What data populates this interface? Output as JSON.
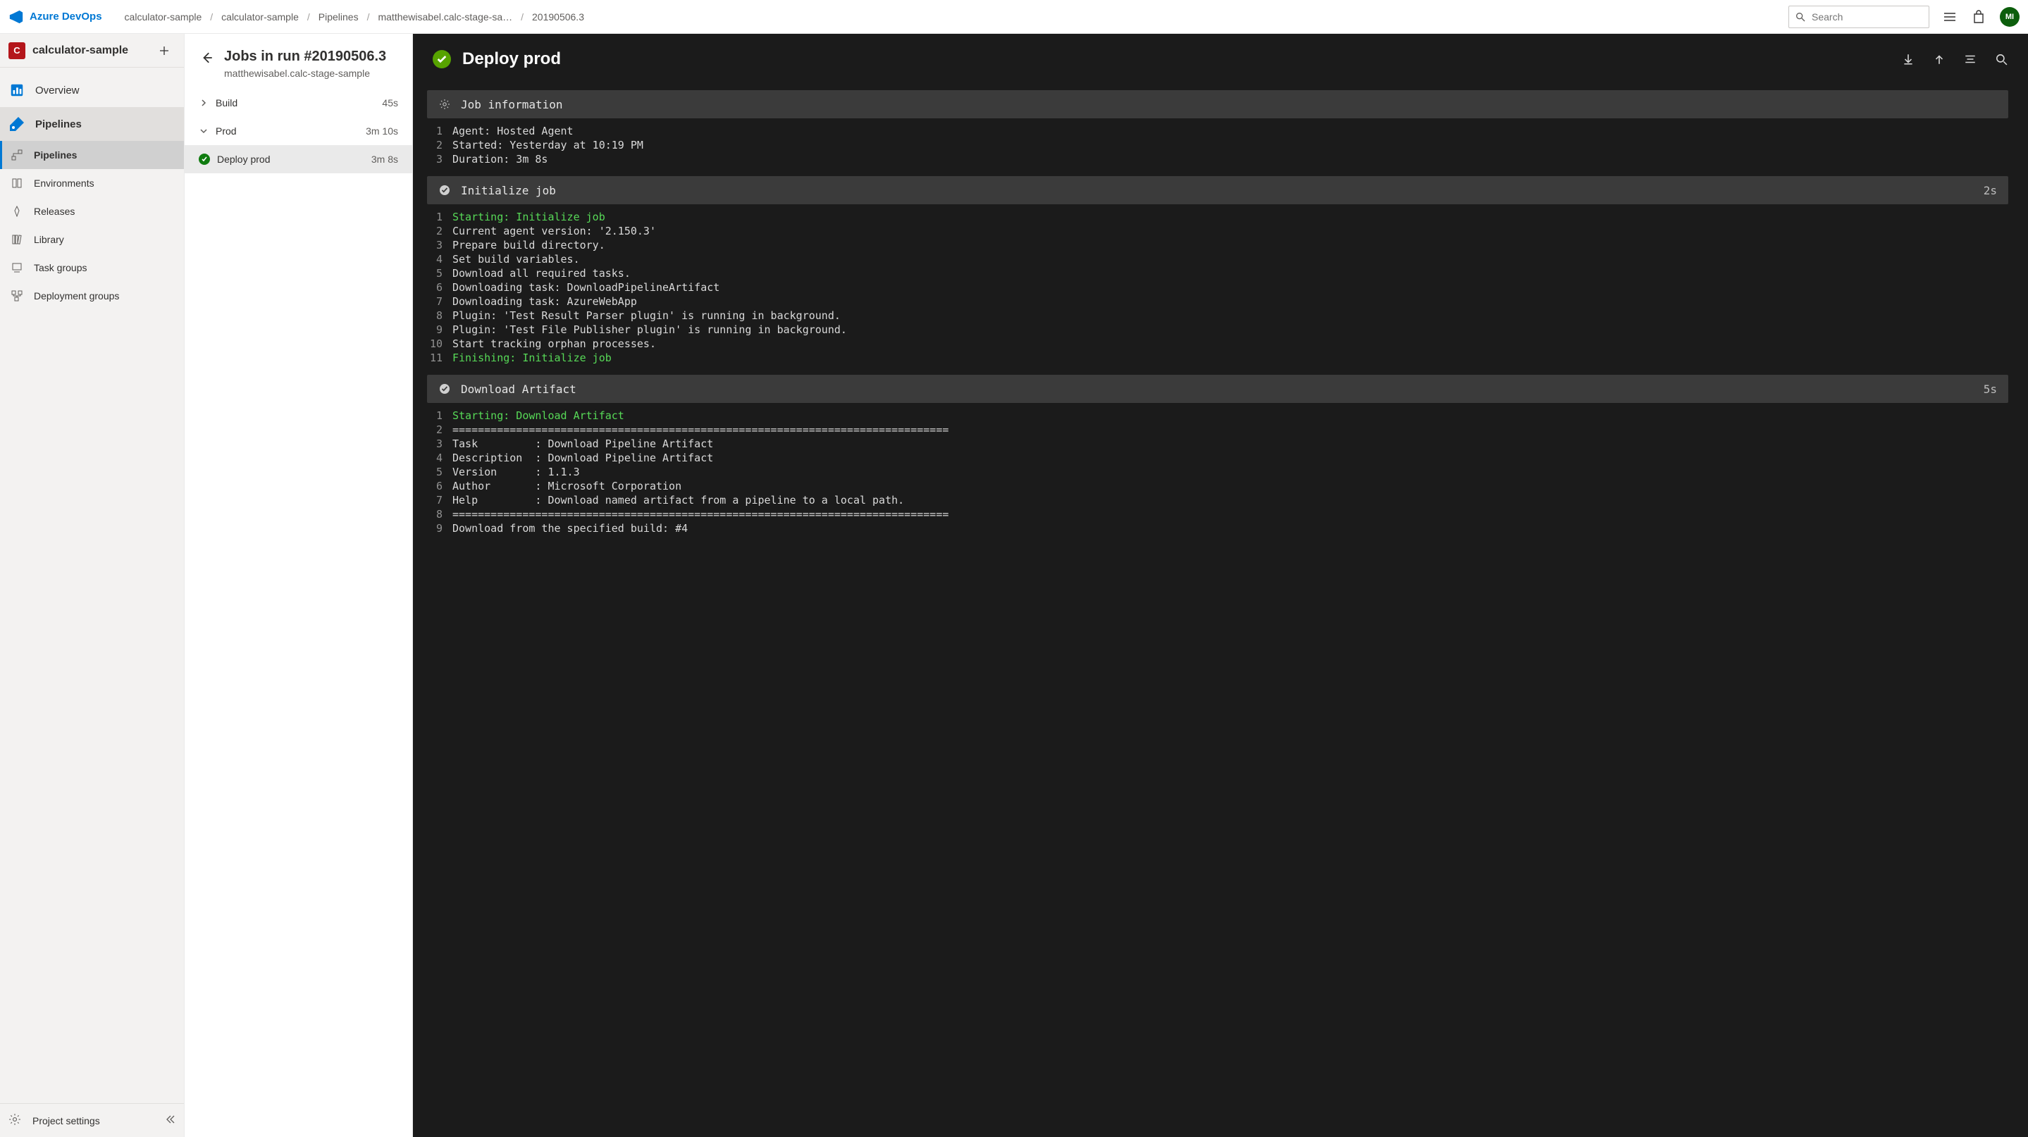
{
  "brand": "Azure DevOps",
  "breadcrumbs": [
    "calculator-sample",
    "calculator-sample",
    "Pipelines",
    "matthewisabel.calc-stage-sa…",
    "20190506.3"
  ],
  "search": {
    "placeholder": "Search"
  },
  "user": {
    "initials": "MI"
  },
  "project": {
    "initial": "C",
    "name": "calculator-sample"
  },
  "nav": {
    "overview": "Overview",
    "pipelines_section": "Pipelines",
    "items": [
      "Pipelines",
      "Environments",
      "Releases",
      "Library",
      "Task groups",
      "Deployment groups"
    ],
    "footer": "Project settings"
  },
  "mid": {
    "title": "Jobs in run #20190506.3",
    "subtitle": "matthewisabel.calc-stage-sample",
    "rows": [
      {
        "type": "stage",
        "expanded": false,
        "label": "Build",
        "dur": "45s"
      },
      {
        "type": "stage",
        "expanded": true,
        "label": "Prod",
        "dur": "3m 10s"
      },
      {
        "type": "job",
        "status": "success",
        "label": "Deploy prod",
        "dur": "3m 8s",
        "active": true
      }
    ]
  },
  "log": {
    "title": "Deploy prod",
    "sections": [
      {
        "icon": "gear",
        "label": "Job information",
        "dur": "",
        "lines": [
          {
            "n": 1,
            "t": "Agent: Hosted Agent"
          },
          {
            "n": 2,
            "t": "Started: Yesterday at 10:19 PM"
          },
          {
            "n": 3,
            "t": "Duration: 3m 8s"
          }
        ]
      },
      {
        "icon": "check",
        "label": "Initialize job",
        "dur": "2s",
        "lines": [
          {
            "n": 1,
            "t": "Starting: Initialize job",
            "c": "green"
          },
          {
            "n": 2,
            "t": "Current agent version: '2.150.3'"
          },
          {
            "n": 3,
            "t": "Prepare build directory."
          },
          {
            "n": 4,
            "t": "Set build variables."
          },
          {
            "n": 5,
            "t": "Download all required tasks."
          },
          {
            "n": 6,
            "t": "Downloading task: DownloadPipelineArtifact"
          },
          {
            "n": 7,
            "t": "Downloading task: AzureWebApp"
          },
          {
            "n": 8,
            "t": "Plugin: 'Test Result Parser plugin' is running in background."
          },
          {
            "n": 9,
            "t": "Plugin: 'Test File Publisher plugin' is running in background."
          },
          {
            "n": 10,
            "t": "Start tracking orphan processes."
          },
          {
            "n": 11,
            "t": "Finishing: Initialize job",
            "c": "green"
          }
        ]
      },
      {
        "icon": "check",
        "label": "Download Artifact",
        "dur": "5s",
        "lines": [
          {
            "n": 1,
            "t": "Starting: Download Artifact",
            "c": "green"
          },
          {
            "n": 2,
            "t": "=============================================================================="
          },
          {
            "n": 3,
            "t": "Task         : Download Pipeline Artifact"
          },
          {
            "n": 4,
            "t": "Description  : Download Pipeline Artifact"
          },
          {
            "n": 5,
            "t": "Version      : 1.1.3"
          },
          {
            "n": 6,
            "t": "Author       : Microsoft Corporation"
          },
          {
            "n": 7,
            "t": "Help         : Download named artifact from a pipeline to a local path."
          },
          {
            "n": 8,
            "t": "=============================================================================="
          },
          {
            "n": 9,
            "t": "Download from the specified build: #4"
          }
        ]
      }
    ]
  }
}
